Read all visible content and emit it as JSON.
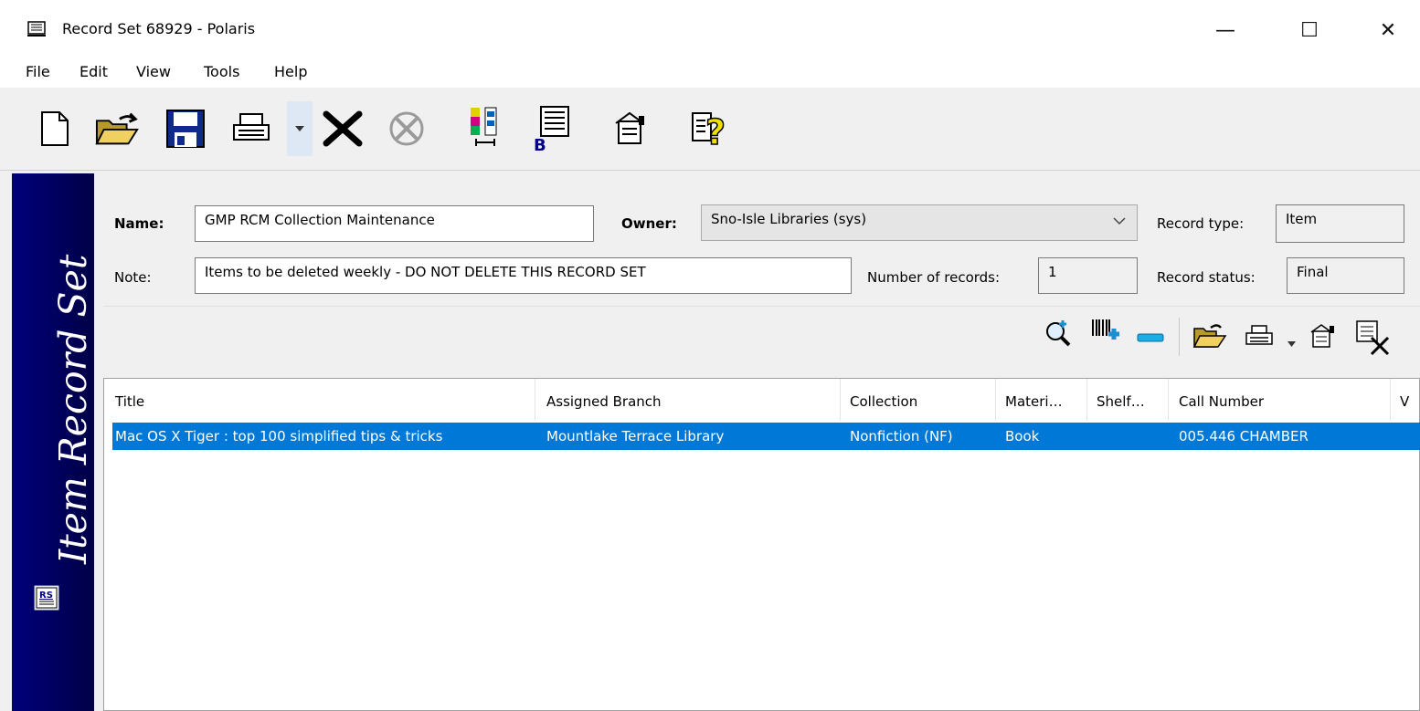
{
  "window": {
    "title": "Record Set 68929 -  Polaris",
    "minimize_glyph": "—",
    "maximize_glyph": "☐",
    "close_glyph": "✕"
  },
  "menu": [
    "File",
    "Edit",
    "View",
    "Tools",
    "Help"
  ],
  "toolbar_icons": [
    "new-document-icon",
    "open-folder-icon",
    "save-disk-icon",
    "print-icon",
    "dropdown-arrow-icon",
    "delete-x-icon",
    "cancel-circle-icon",
    "columns-icon",
    "barcode-list-icon",
    "properties-icon",
    "help-icon"
  ],
  "banner": {
    "label": "Item Record Set"
  },
  "form": {
    "name_label": "Name:",
    "name_value": "GMP RCM Collection Maintenance",
    "owner_label": "Owner:",
    "owner_value": "Sno-Isle Libraries (sys)",
    "record_type_label": "Record type:",
    "record_type_value": "Item",
    "note_label": "Note:",
    "note_value": "Items to be deleted weekly - DO NOT DELETE THIS RECORD SET",
    "num_records_label": "Number of records:",
    "num_records_value": "1",
    "record_status_label": "Record status:",
    "record_status_value": "Final"
  },
  "list": {
    "columns": [
      "Title",
      "Assigned Branch",
      "Collection",
      "Materi…",
      "Shelf…",
      "Call Number",
      "V"
    ],
    "rows": [
      {
        "title": "Mac OS X Tiger : top 100 simplified tips & tricks",
        "branch": "Mountlake Terrace Library",
        "collection": "Nonfiction (NF)",
        "material": "Book",
        "shelf": "",
        "call_number": "005.446 CHAMBER"
      }
    ]
  },
  "colors": {
    "banner": "#00007a",
    "selection": "#0078d7"
  }
}
